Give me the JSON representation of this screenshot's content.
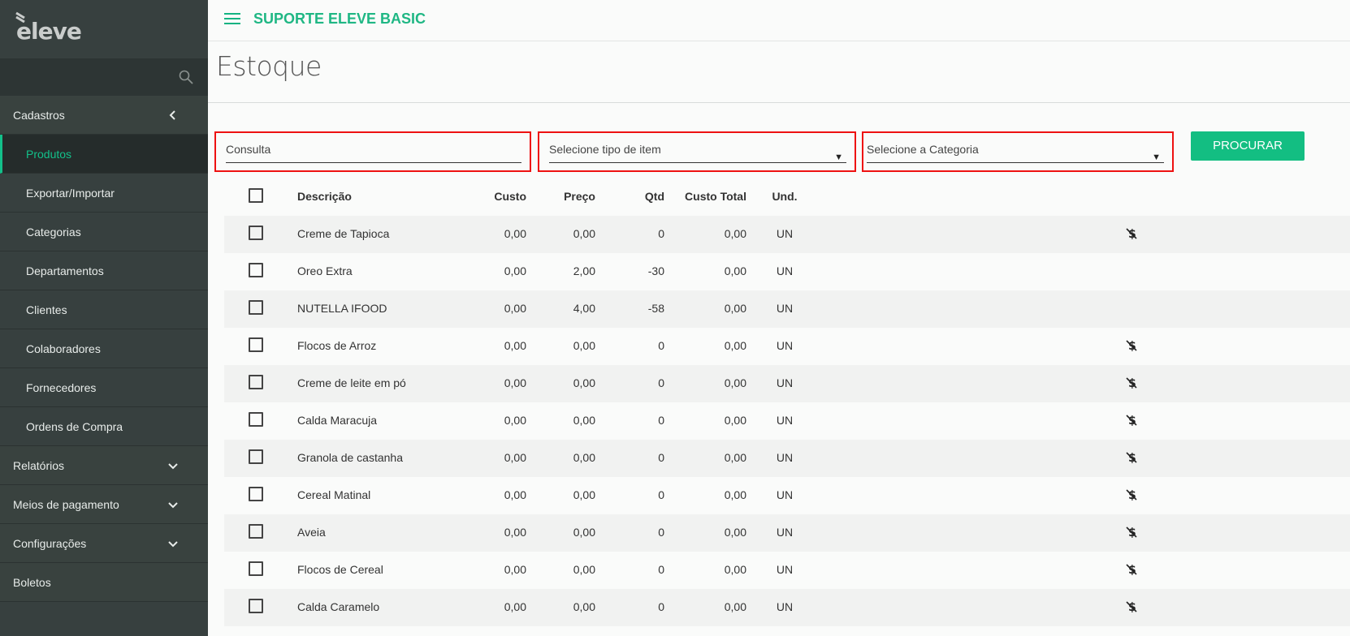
{
  "brand": {
    "logo_text": "eleve"
  },
  "sidebar": {
    "items": [
      {
        "label": "Cadastros",
        "chevron": "chevron-left"
      },
      {
        "label": "Produtos",
        "active": true
      },
      {
        "label": "Exportar/Importar"
      },
      {
        "label": "Categorias"
      },
      {
        "label": "Departamentos"
      },
      {
        "label": "Clientes"
      },
      {
        "label": "Colaboradores"
      },
      {
        "label": "Fornecedores"
      },
      {
        "label": "Ordens de Compra"
      },
      {
        "label": "Relatórios",
        "chevron": "chevron-down"
      },
      {
        "label": "Meios de pagamento",
        "chevron": "chevron-down"
      },
      {
        "label": "Configurações",
        "chevron": "chevron-down"
      },
      {
        "label": "Boletos"
      }
    ]
  },
  "header": {
    "title": "SUPORTE ELEVE BASIC"
  },
  "page": {
    "title": "Estoque"
  },
  "filters": {
    "consulta_placeholder": "Consulta",
    "tipo_item": "Selecione tipo de item",
    "categoria": "Selecione a Categoria",
    "search_button": "PROCURAR"
  },
  "table": {
    "headers": {
      "descricao": "Descrição",
      "custo": "Custo",
      "preco": "Preço",
      "qtd": "Qtd",
      "und": "Und.",
      "custo_total": "Custo Total"
    },
    "rows": [
      {
        "descricao": "Creme de Tapioca",
        "custo": "0,00",
        "preco": "0,00",
        "qtd": "0",
        "und": "UN",
        "custo_total": "0,00",
        "icon": true
      },
      {
        "descricao": "Oreo Extra",
        "custo": "0,00",
        "preco": "2,00",
        "qtd": "-30",
        "und": "UN",
        "custo_total": "0,00",
        "icon": false
      },
      {
        "descricao": "NUTELLA IFOOD",
        "custo": "0,00",
        "preco": "4,00",
        "qtd": "-58",
        "und": "UN",
        "custo_total": "0,00",
        "icon": false
      },
      {
        "descricao": "Flocos de Arroz",
        "custo": "0,00",
        "preco": "0,00",
        "qtd": "0",
        "und": "UN",
        "custo_total": "0,00",
        "icon": true
      },
      {
        "descricao": "Creme de leite em pó",
        "custo": "0,00",
        "preco": "0,00",
        "qtd": "0",
        "und": "UN",
        "custo_total": "0,00",
        "icon": true
      },
      {
        "descricao": "Calda Maracuja",
        "custo": "0,00",
        "preco": "0,00",
        "qtd": "0",
        "und": "UN",
        "custo_total": "0,00",
        "icon": true
      },
      {
        "descricao": "Granola de castanha",
        "custo": "0,00",
        "preco": "0,00",
        "qtd": "0",
        "und": "UN",
        "custo_total": "0,00",
        "icon": true
      },
      {
        "descricao": "Cereal Matinal",
        "custo": "0,00",
        "preco": "0,00",
        "qtd": "0",
        "und": "UN",
        "custo_total": "0,00",
        "icon": true
      },
      {
        "descricao": "Aveia",
        "custo": "0,00",
        "preco": "0,00",
        "qtd": "0",
        "und": "UN",
        "custo_total": "0,00",
        "icon": true
      },
      {
        "descricao": "Flocos de Cereal",
        "custo": "0,00",
        "preco": "0,00",
        "qtd": "0",
        "und": "UN",
        "custo_total": "0,00",
        "icon": true
      },
      {
        "descricao": "Calda Caramelo",
        "custo": "0,00",
        "preco": "0,00",
        "qtd": "0",
        "und": "UN",
        "custo_total": "0,00",
        "icon": true
      }
    ]
  },
  "colors": {
    "accent": "#13be82",
    "sidebar_bg": "#37403f",
    "highlight_border": "#e11111"
  }
}
